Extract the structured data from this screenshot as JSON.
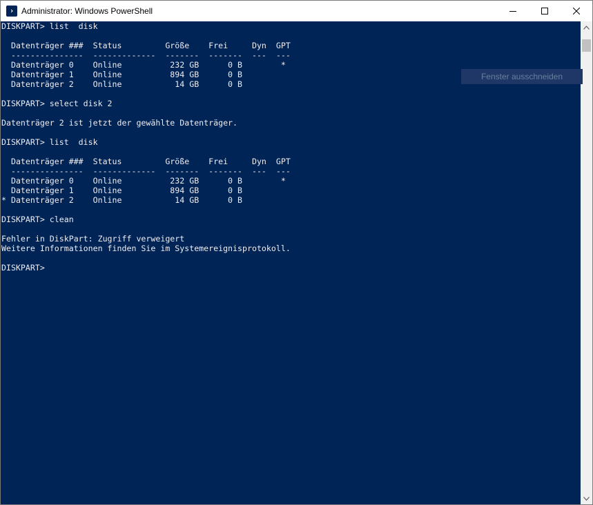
{
  "window": {
    "title": "Administrator: Windows PowerShell",
    "icon": "powershell-icon",
    "buttons": {
      "minimize": "minimize-icon",
      "maximize": "maximize-icon",
      "close": "close-icon"
    }
  },
  "console": {
    "background": "#012456",
    "foreground": "#eeedf0",
    "lines": [
      "DISKPART> list  disk",
      "",
      "  Datenträger ###  Status         Größe    Frei     Dyn  GPT",
      "  ---------------  -------------  -------  -------  ---  ---",
      "  Datenträger 0    Online          232 GB      0 B        *",
      "  Datenträger 1    Online          894 GB      0 B",
      "  Datenträger 2    Online           14 GB      0 B",
      "",
      "DISKPART> select disk 2",
      "",
      "Datenträger 2 ist jetzt der gewählte Datenträger.",
      "",
      "DISKPART> list  disk",
      "",
      "  Datenträger ###  Status         Größe    Frei     Dyn  GPT",
      "  ---------------  -------------  -------  -------  ---  ---",
      "  Datenträger 0    Online          232 GB      0 B        *",
      "  Datenträger 1    Online          894 GB      0 B",
      "* Datenträger 2    Online           14 GB      0 B",
      "",
      "DISKPART> clean",
      "",
      "Fehler in DiskPart: Zugriff verweigert",
      "Weitere Informationen finden Sie im Systemereignisprotokoll.",
      "",
      "DISKPART>"
    ]
  },
  "tooltip": {
    "text": "Fenster ausschneiden"
  }
}
